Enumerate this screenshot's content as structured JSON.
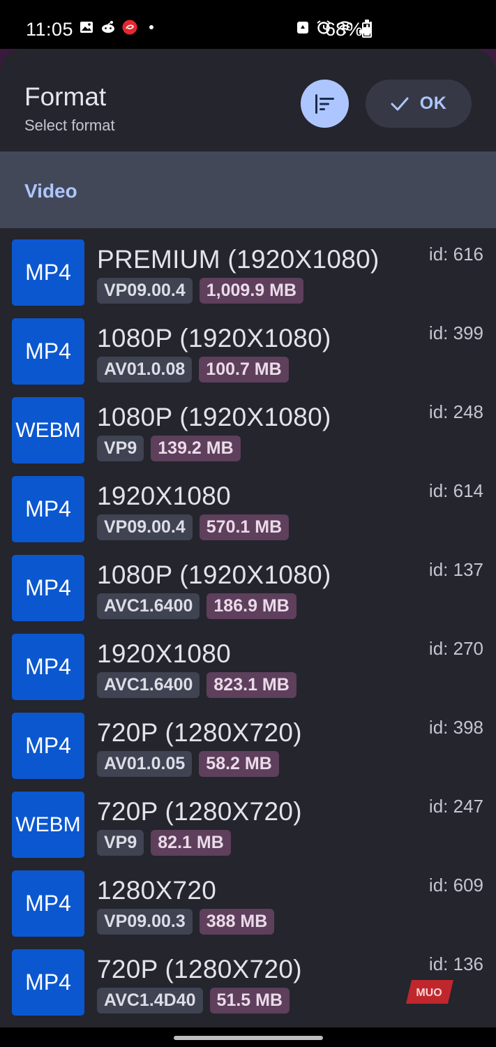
{
  "status_bar": {
    "time": "11:05",
    "battery": "68%",
    "left_icons": [
      "gallery-icon",
      "reddit-icon",
      "airtel-icon",
      "dot-icon"
    ],
    "right_icons": [
      "recycle-icon",
      "alarm-icon",
      "wifi-icon",
      "signal-icon",
      "battery-icon"
    ]
  },
  "header": {
    "title": "Format",
    "subtitle": "Select format",
    "ok_label": "OK"
  },
  "section": {
    "label": "Video"
  },
  "formats": [
    {
      "container": "MP4",
      "title": "PREMIUM (1920X1080)",
      "codec": "VP09.00.4",
      "size": "1,009.9 MB",
      "id": "id: 616"
    },
    {
      "container": "MP4",
      "title": "1080P (1920X1080)",
      "codec": "AV01.0.08",
      "size": "100.7 MB",
      "id": "id: 399"
    },
    {
      "container": "WEBM",
      "title": "1080P (1920X1080)",
      "codec": "VP9",
      "size": "139.2 MB",
      "id": "id: 248"
    },
    {
      "container": "MP4",
      "title": "1920X1080",
      "codec": "VP09.00.4",
      "size": "570.1 MB",
      "id": "id: 614"
    },
    {
      "container": "MP4",
      "title": "1080P (1920X1080)",
      "codec": "AVC1.6400",
      "size": "186.9 MB",
      "id": "id: 137"
    },
    {
      "container": "MP4",
      "title": "1920X1080",
      "codec": "AVC1.6400",
      "size": "823.1 MB",
      "id": "id: 270"
    },
    {
      "container": "MP4",
      "title": "720P (1280X720)",
      "codec": "AV01.0.05",
      "size": "58.2 MB",
      "id": "id: 398"
    },
    {
      "container": "WEBM",
      "title": "720P (1280X720)",
      "codec": "VP9",
      "size": "82.1 MB",
      "id": "id: 247"
    },
    {
      "container": "MP4",
      "title": "1280X720",
      "codec": "VP09.00.3",
      "size": "388 MB",
      "id": "id: 609"
    },
    {
      "container": "MP4",
      "title": "720P (1280X720)",
      "codec": "AVC1.4D40",
      "size": "51.5 MB",
      "id": "id: 136"
    }
  ],
  "colors": {
    "accent": "#aec6ff",
    "badge": "#0b57d0",
    "sheet": "#24252d",
    "section": "#434858",
    "chip_codec": "#3f4352",
    "chip_size": "#5e3f5c"
  }
}
